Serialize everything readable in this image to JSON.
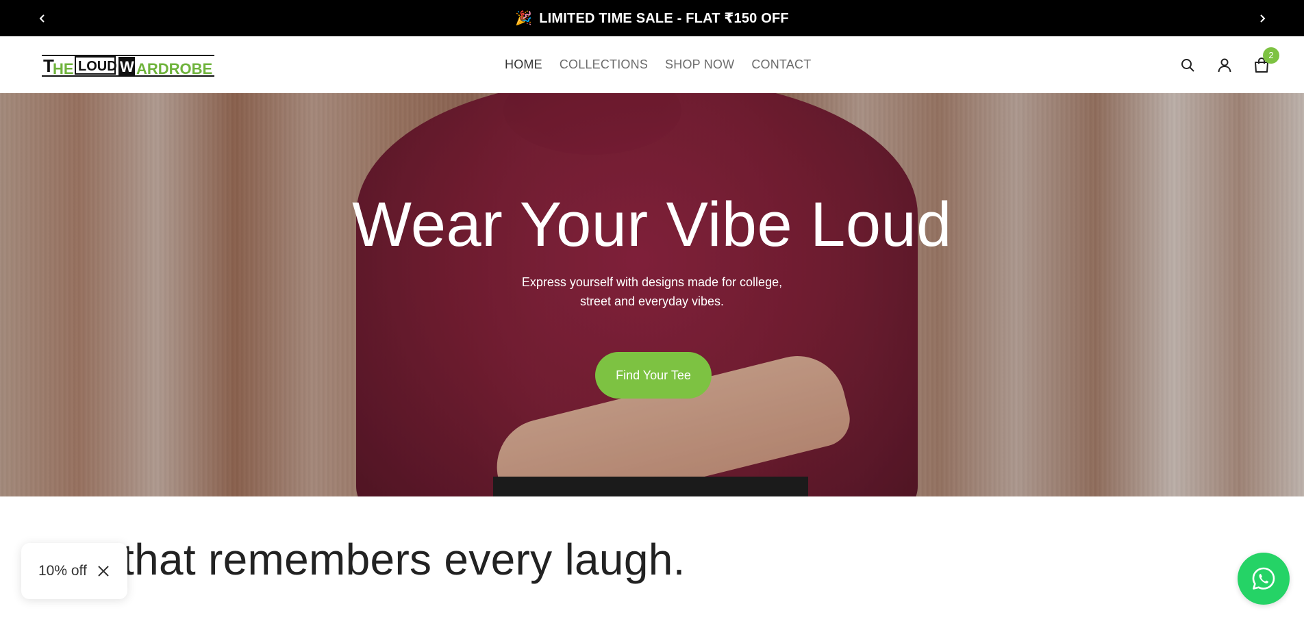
{
  "announcement": {
    "text": "LIMITED TIME SALE - FLAT ₹150 OFF",
    "emoji": "🎉",
    "prev_icon": "chevron-left-icon",
    "next_icon": "chevron-right-icon"
  },
  "header": {
    "logo_text": "THE LOUD WARDROBE",
    "nav": [
      {
        "label": "HOME",
        "active": true
      },
      {
        "label": "COLLECTIONS",
        "active": false
      },
      {
        "label": "SHOP NOW",
        "active": false
      },
      {
        "label": "CONTACT",
        "active": false
      }
    ],
    "icons": [
      "search-icon",
      "account-icon",
      "cart-icon"
    ],
    "cart_count": "2"
  },
  "hero": {
    "title": "Wear Your Vibe Loud",
    "subtitle_line1": "Express yourself with designs made for college,",
    "subtitle_line2": "street and everyday vibes.",
    "cta_label": "Find Your Tee"
  },
  "section": {
    "tagline": "that remembers every laugh."
  },
  "discount_popup": {
    "label": "10% off",
    "close_icon": "close-icon"
  },
  "whatsapp": {
    "icon": "whatsapp-icon"
  },
  "colors": {
    "accent": "#7dc242",
    "whatsapp": "#25d366",
    "announcement_bg": "#000000"
  }
}
